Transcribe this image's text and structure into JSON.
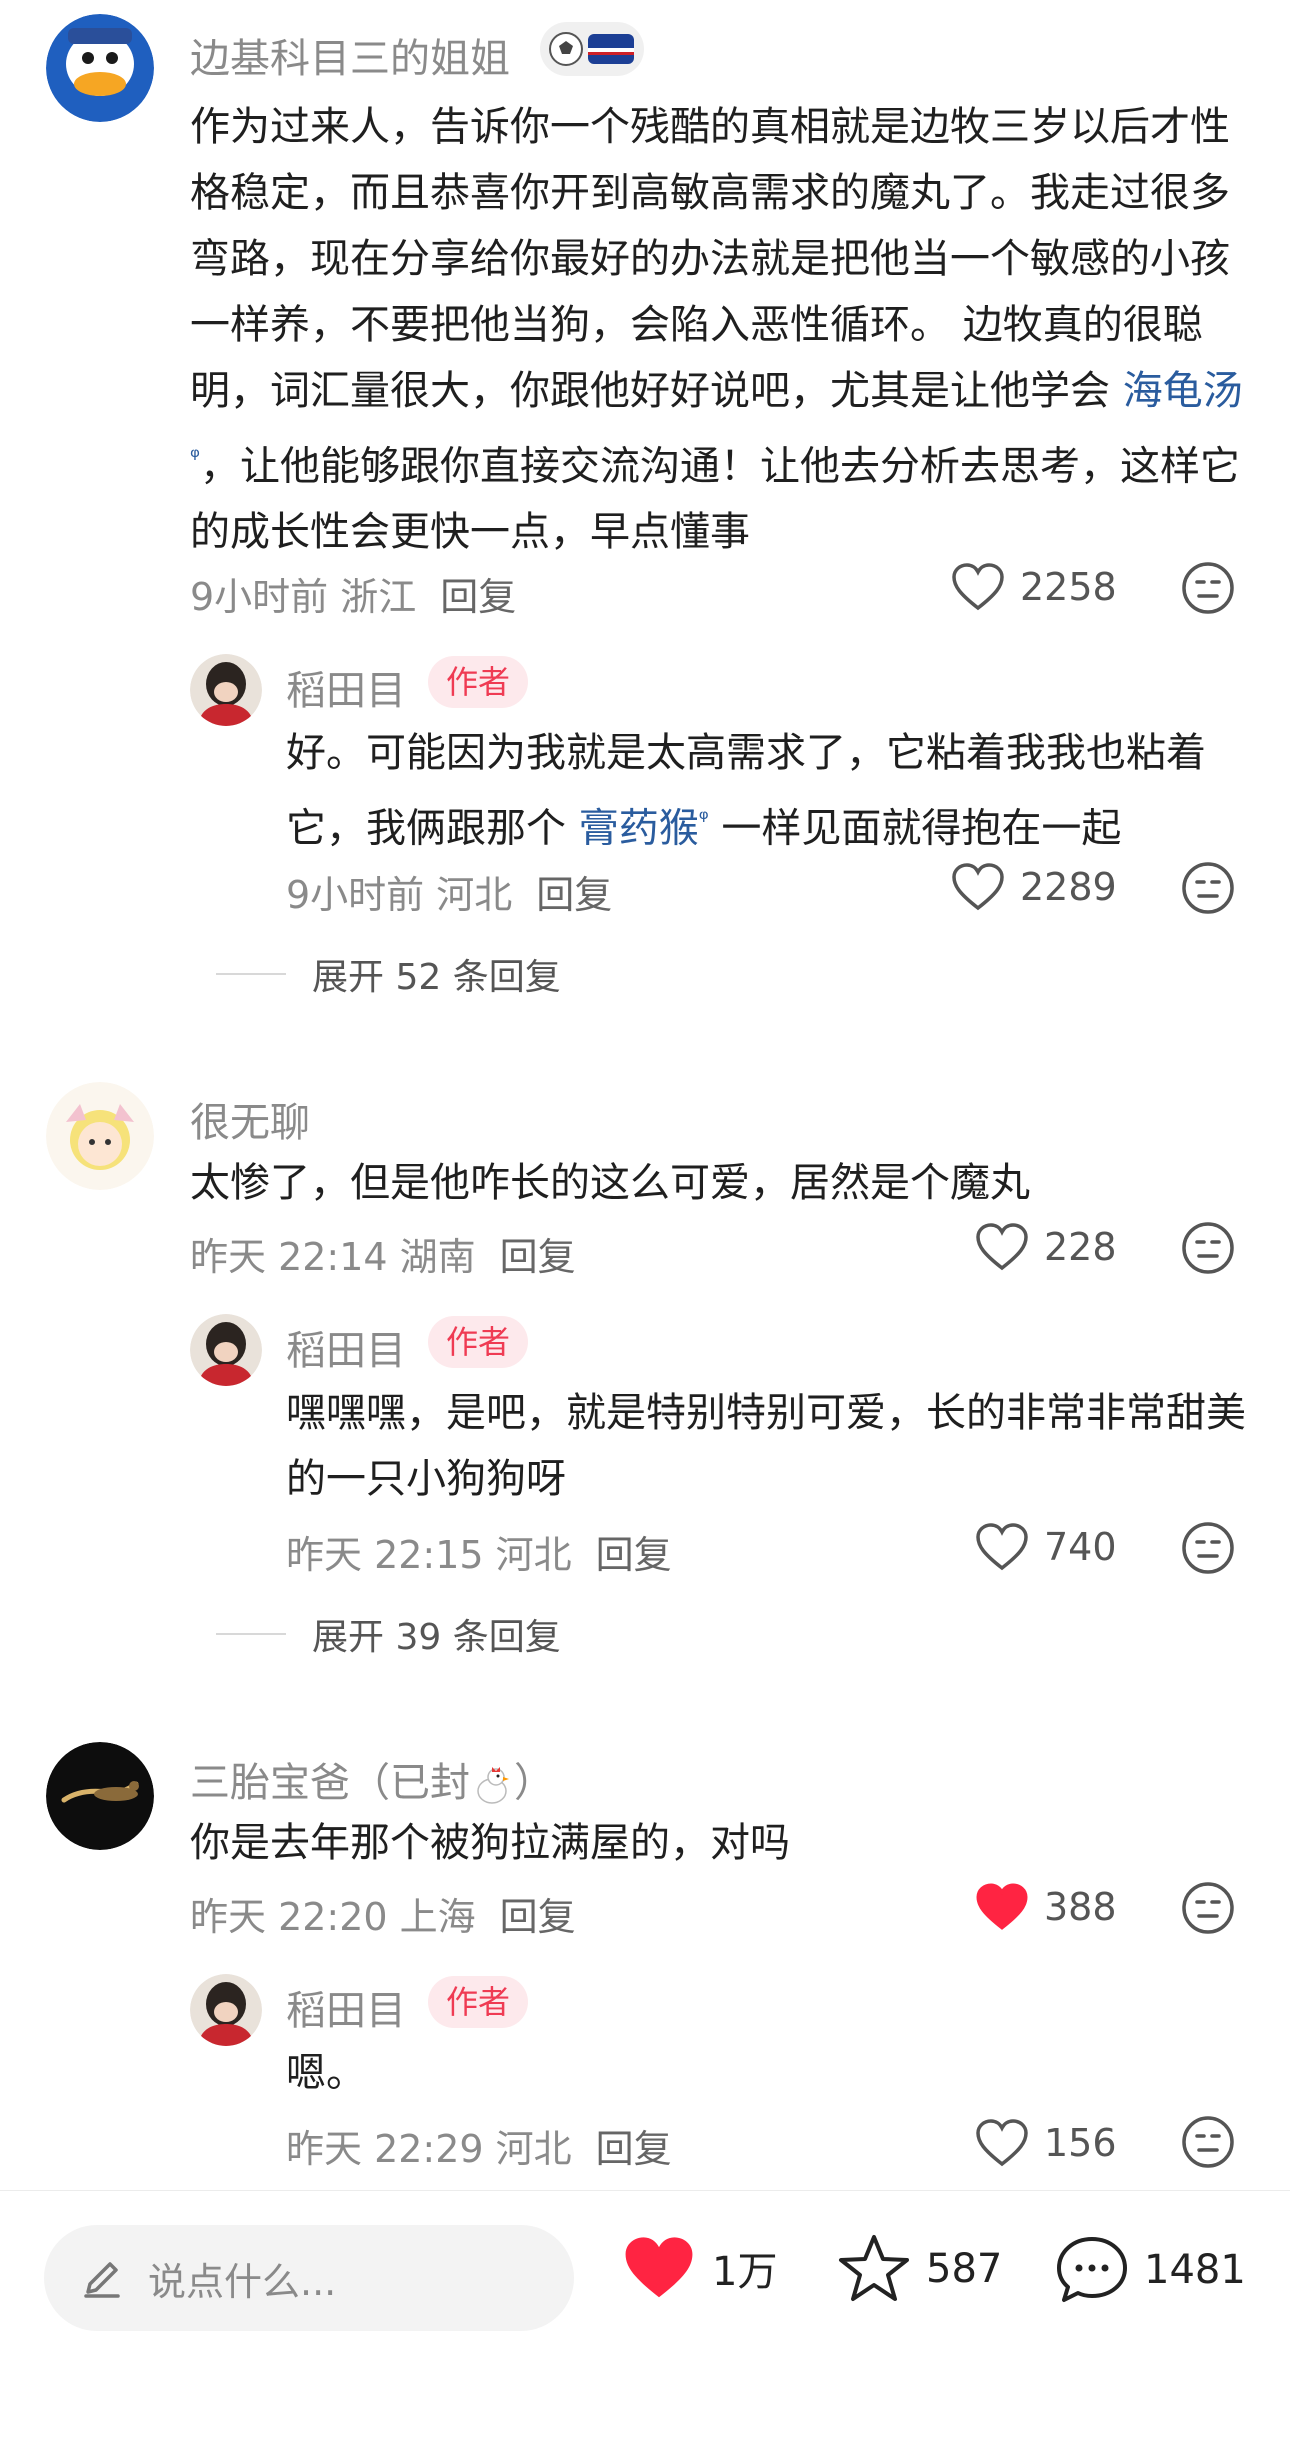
{
  "comments": [
    {
      "user": "边基科目三的姐姐",
      "text_before": "作为过来人，告诉你一个残酷的真相就是边牧三岁以后才性格稳定，而且恭喜你开到高敏高需求的魔丸了。我走过很多弯路，现在分享给你最好的办法就是把他当一个敏感的小孩一样养，不要把他当狗，会陷入恶性循环。 边牧真的很聪明，词汇量很大，你跟他好好说吧，尤其是让他学会 ",
      "tag": "海龟汤",
      "text_after": "，让他能够跟你直接交流沟通！让他去分析去思考，这样它的成长性会更快一点，早点懂事",
      "time": "9小时前 浙江",
      "reply_label": "回复",
      "likes": "2258",
      "reply": {
        "user": "稻田目",
        "author_label": "作者",
        "text_before": "好。可能因为我就是太高需求了，它粘着我我也粘着它，我俩跟那个 ",
        "tag": "膏药猴",
        "text_after": " 一样见面就得抱在一起",
        "time": "9小时前 河北",
        "reply_label": "回复",
        "likes": "2289"
      },
      "expand_label": "展开 52 条回复"
    },
    {
      "user": "很无聊",
      "text": "太惨了，但是他咋长的这么可爱，居然是个魔丸",
      "time": "昨天 22:14 湖南",
      "reply_label": "回复",
      "likes": "228",
      "reply": {
        "user": "稻田目",
        "author_label": "作者",
        "text": "嘿嘿嘿，是吧，就是特别特别可爱，长的非常非常甜美的一只小狗狗呀",
        "time": "昨天 22:15 河北",
        "reply_label": "回复",
        "likes": "740"
      },
      "expand_label": "展开 39 条回复"
    },
    {
      "user": "三胎宝爸（已封",
      "user_suffix": "）",
      "text": "你是去年那个被狗拉满屋的，对吗",
      "time": "昨天 22:20 上海",
      "reply_label": "回复",
      "likes": "388",
      "liked": true,
      "reply": {
        "user": "稻田目",
        "author_label": "作者",
        "text": "嗯。",
        "time": "昨天 22:29 河北",
        "reply_label": "回复",
        "likes": "156"
      }
    }
  ],
  "bottom_bar": {
    "input_placeholder": "说点什么...",
    "like_count": "1万",
    "favorite_count": "587",
    "comment_count": "1481",
    "icons": [
      "pencil-icon",
      "heart-icon",
      "star-icon",
      "comment-icon"
    ],
    "colors": {
      "liked_red": "#ff2442",
      "tag_blue": "#2a5c9e",
      "author_pink": "#ef3b53"
    }
  }
}
